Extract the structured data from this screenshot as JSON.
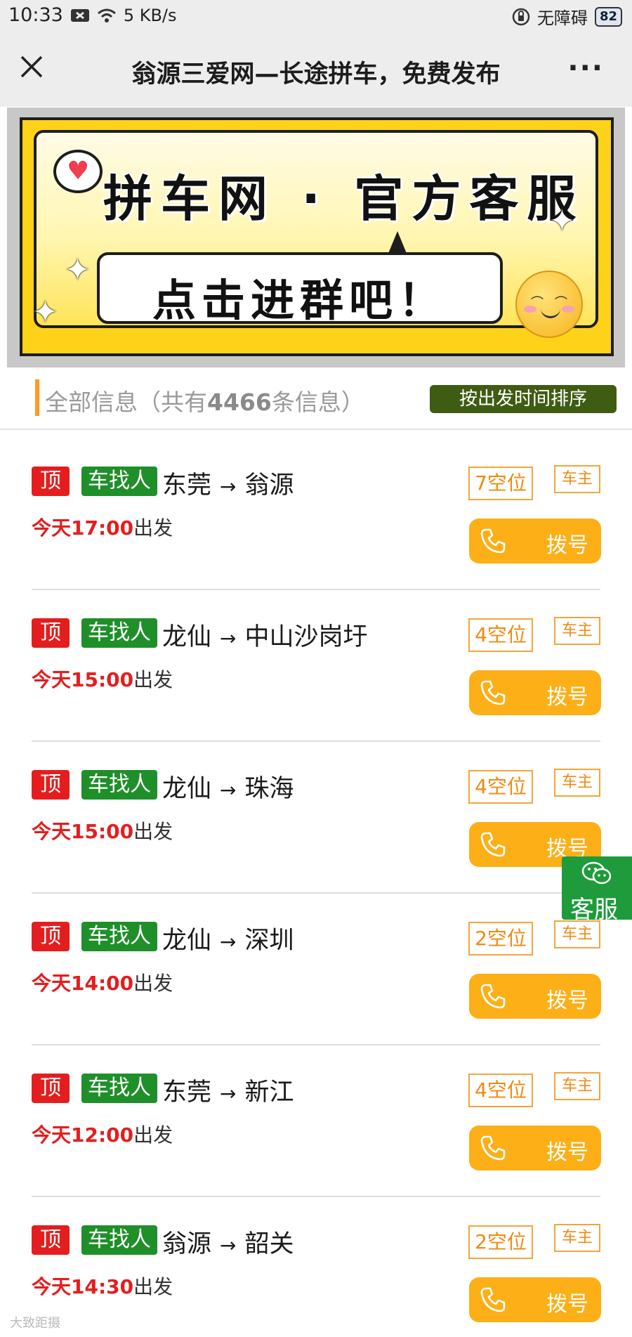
{
  "status_bar": {
    "time": "10:33",
    "speed": "5 KB/s",
    "accessibility": "无障碍",
    "battery": "82"
  },
  "title_bar": {
    "title": "翁源三爱网—长途拼车，免费发布",
    "more": "···"
  },
  "banner": {
    "heading": "拼车网 · 官方客服",
    "cta": "点击进群吧！",
    "colors": {
      "background": "#ffd21a",
      "border": "#1d1d1d"
    }
  },
  "list_header": {
    "prefix": "全部信息（共有",
    "count": "4466",
    "suffix": "条信息）",
    "sort_button": "按出发时间排序"
  },
  "listings": [
    {
      "top": "顶",
      "type": "车找人",
      "from": "东莞",
      "arrow": "→",
      "to": "翁源",
      "time": "今天17:00",
      "depart_suffix": "出发",
      "seats": "7空位",
      "role": "车主",
      "dial": "拨号"
    },
    {
      "top": "顶",
      "type": "车找人",
      "from": "龙仙",
      "arrow": "→",
      "to": "中山沙岗圩",
      "time": "今天15:00",
      "depart_suffix": "出发",
      "seats": "4空位",
      "role": "车主",
      "dial": "拨号"
    },
    {
      "top": "顶",
      "type": "车找人",
      "from": "龙仙",
      "arrow": "→",
      "to": "珠海",
      "time": "今天15:00",
      "depart_suffix": "出发",
      "seats": "4空位",
      "role": "车主",
      "dial": "拨号"
    },
    {
      "top": "顶",
      "type": "车找人",
      "from": "龙仙",
      "arrow": "→",
      "to": "深圳",
      "time": "今天14:00",
      "depart_suffix": "出发",
      "seats": "2空位",
      "role": "车主",
      "dial": "拨号"
    },
    {
      "top": "顶",
      "type": "车找人",
      "from": "东莞",
      "arrow": "→",
      "to": "新江",
      "time": "今天12:00",
      "depart_suffix": "出发",
      "seats": "4空位",
      "role": "车主",
      "dial": "拨号"
    },
    {
      "top": "顶",
      "type": "车找人",
      "from": "翁源",
      "arrow": "→",
      "to": "韶关",
      "time": "今天14:30",
      "depart_suffix": "出发",
      "seats": "2空位",
      "role": "车主",
      "dial": "拨号"
    }
  ],
  "float_service": {
    "label": "客服"
  },
  "watermark": "大致距摄",
  "colors": {
    "accent_orange": "#fcaf17",
    "top_red": "#e41e1e",
    "type_green": "#1f8f2a",
    "sort_green": "#3f5c13"
  }
}
